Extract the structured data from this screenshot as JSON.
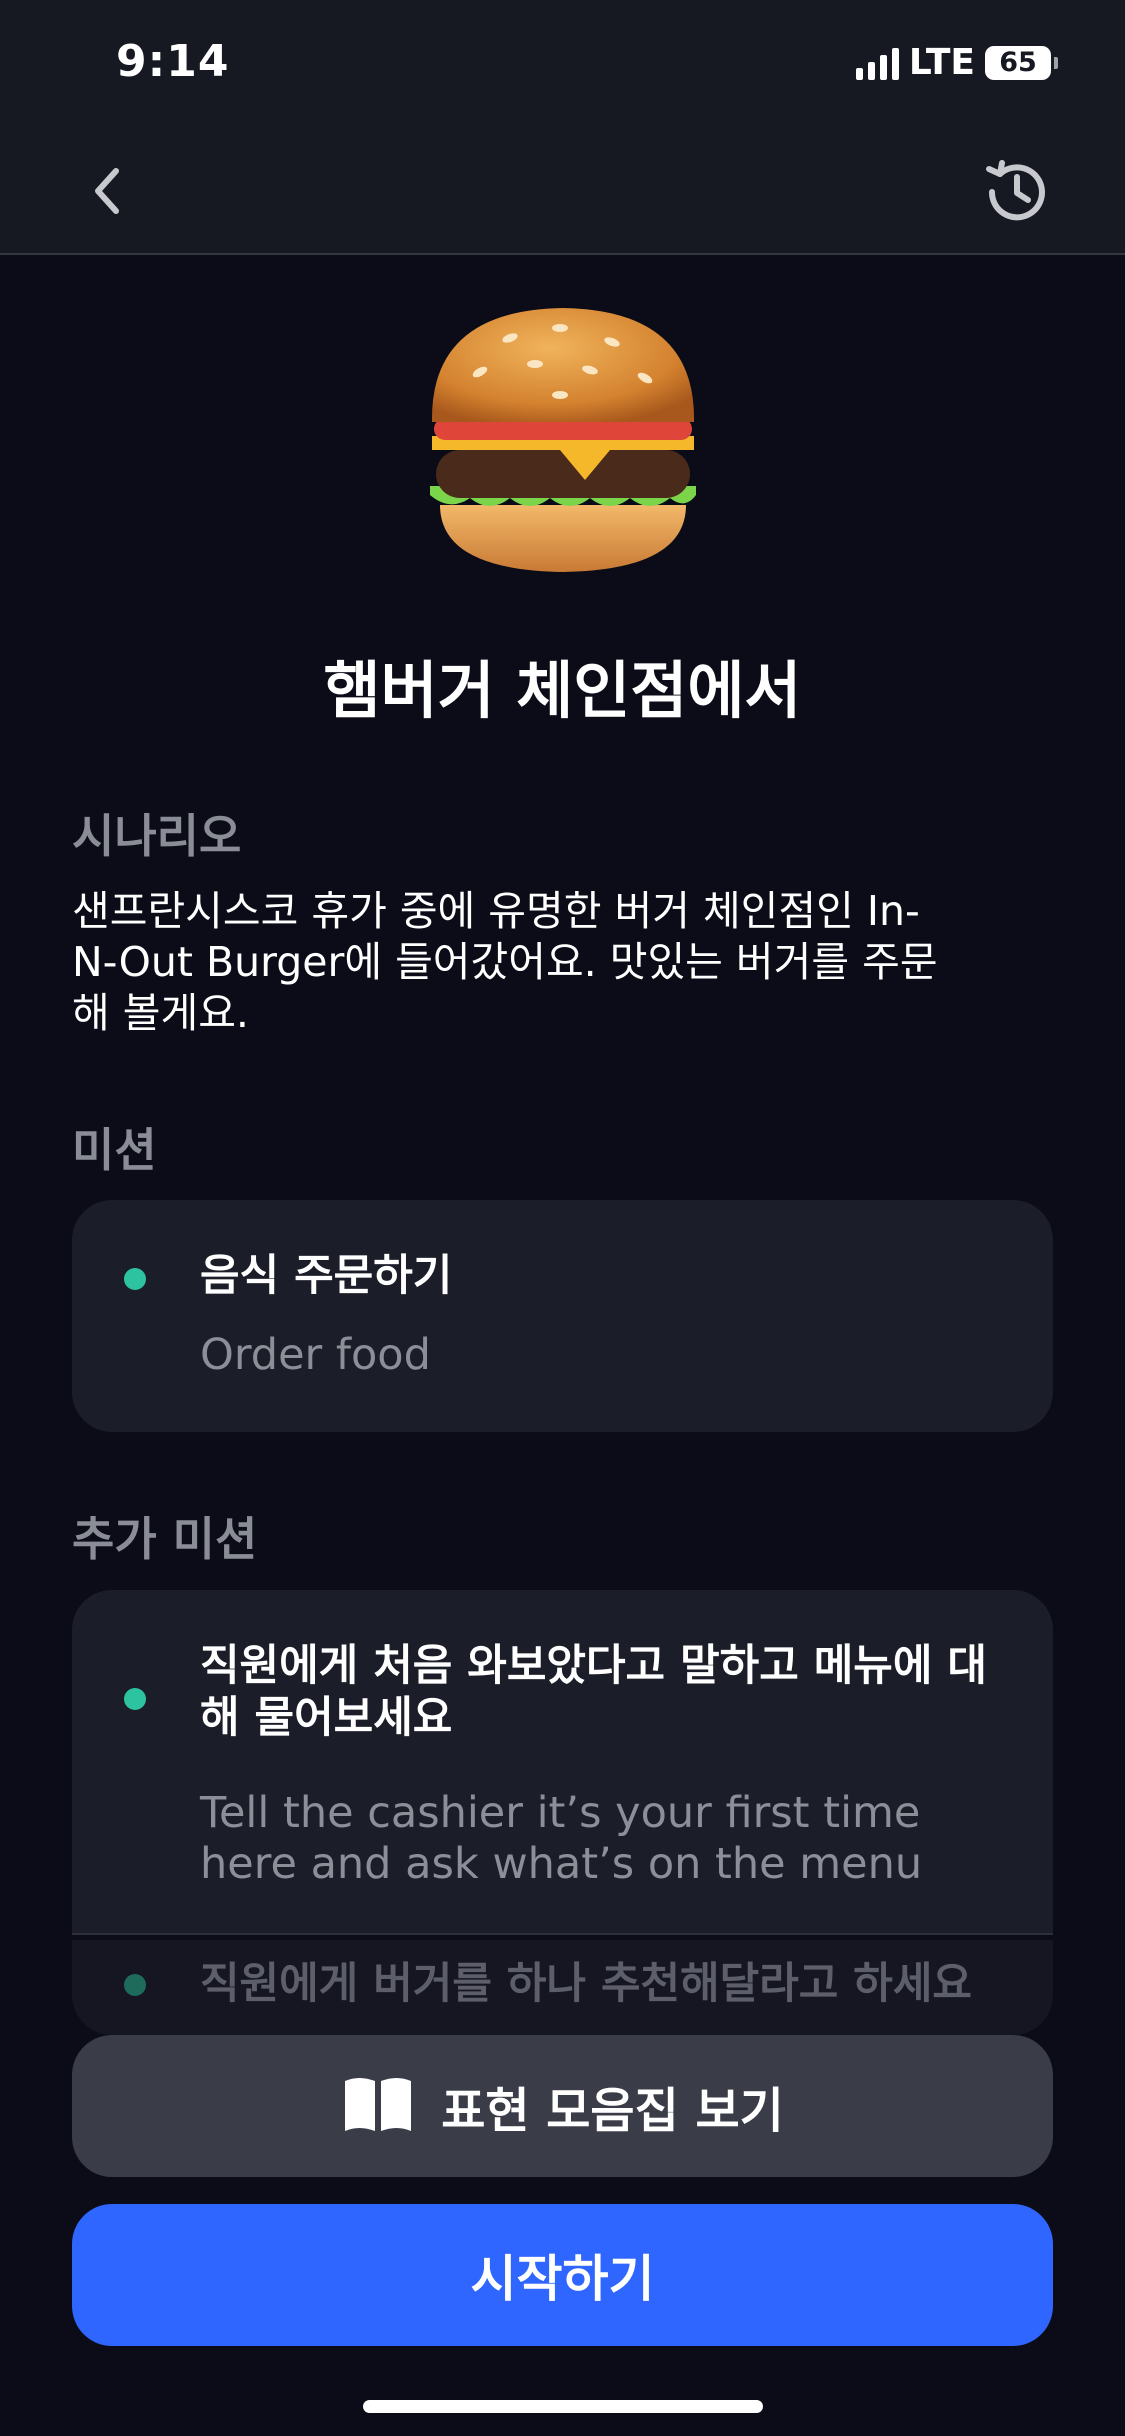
{
  "status": {
    "time": "9:14",
    "network": "LTE",
    "battery": "65"
  },
  "nav": {
    "back_icon": "chevron-left-icon",
    "history_icon": "history-clock-icon"
  },
  "hero": {
    "icon": "hamburger-icon"
  },
  "title": "햄버거 체인점에서",
  "scenario": {
    "label": "시나리오",
    "lines": [
      "샌프란시스코 휴가 중에 유명한 버거 체인점인 In-",
      "N-Out Burger에 들어갔어요. 맛있는 버거를 주문",
      "해 볼게요."
    ]
  },
  "mission": {
    "label": "미션",
    "item": {
      "ko": "음식 주문하기",
      "en": "Order food"
    }
  },
  "extra_missions": {
    "label": "추가 미션",
    "items": [
      {
        "ko_lines": [
          "직원에게 처음 와보았다고 말하고 메뉴에 대",
          "해 물어보세요"
        ],
        "en_lines": [
          "Tell the cashier it’s your first time",
          "here and ask what’s on the menu"
        ]
      },
      {
        "ko": "직원에게 버거를 하나 추천해달라고 하세요"
      }
    ]
  },
  "buttons": {
    "phrases": {
      "label": "표현 모음집 보기",
      "icon": "open-book-icon"
    },
    "start": {
      "label": "시작하기"
    }
  },
  "colors": {
    "background": "#0b0c17",
    "card": "#1b1d28",
    "accent": "#2f66ff",
    "dot": "#2ec3a0",
    "secondary_text": "#8c8e98"
  }
}
